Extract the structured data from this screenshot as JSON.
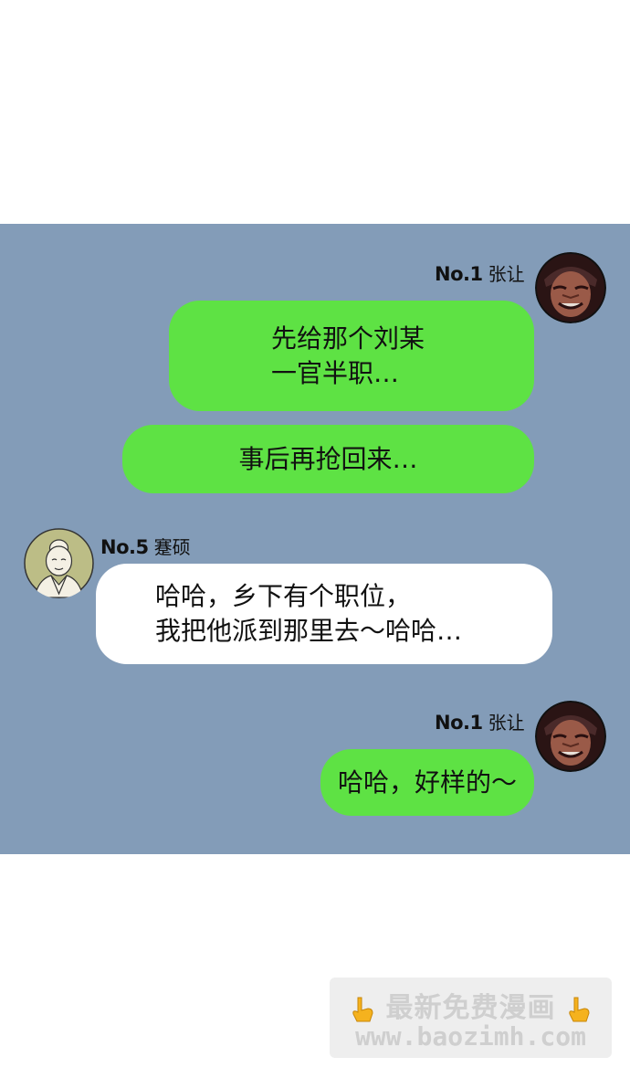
{
  "messages": [
    {
      "sender_num": "No.1",
      "sender_name": "张让",
      "lines": [
        "先给那个刘某",
        "一官半职…"
      ]
    },
    {
      "lines": [
        "事后再抢回来…"
      ]
    },
    {
      "sender_num": "No.5",
      "sender_name": "蹇硕",
      "lines": [
        "哈哈，乡下有个职位，",
        "我把他派到那里去～哈哈…"
      ]
    },
    {
      "sender_num": "No.1",
      "sender_name": "张让",
      "lines": [
        "哈哈，好样的～"
      ]
    }
  ],
  "watermark": {
    "line1": "最新免费漫画",
    "line2": "www.baozimh.com"
  },
  "colors": {
    "panel": "#839cb8",
    "green_bubble": "#5ee244",
    "white_bubble": "#ffffff"
  },
  "icons": [
    "avatar-zhangrang",
    "avatar-jianshuo",
    "pointing-hand-icon"
  ]
}
